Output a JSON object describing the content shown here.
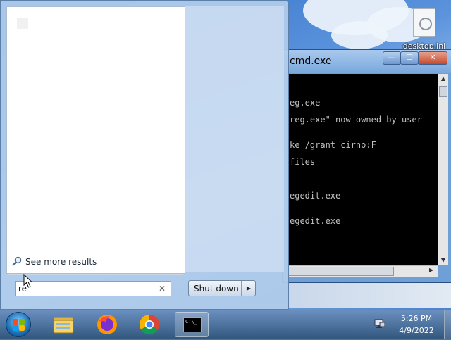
{
  "desktop": {
    "icon_label": "desktop.ini"
  },
  "cmd_window": {
    "title": "cmd.exe",
    "buttons": {
      "minimize": "—",
      "maximize": "☐",
      "close": "✕"
    },
    "lines": [
      "eg.exe",
      "reg.exe\" now owned by user",
      "ke /grant cirno:F",
      "files",
      "egedit.exe",
      "egedit.exe"
    ]
  },
  "start_menu": {
    "see_more_label": "See more results",
    "search": {
      "value": "re",
      "placeholder": ""
    },
    "shutdown_label": "Shut down"
  },
  "taskbar": {
    "cmd_glyph": "C:\\_",
    "clock": {
      "time": "5:26 PM",
      "date": "4/9/2022"
    }
  },
  "colors": {
    "desktop_blue": "#3d79c9",
    "start_menu_glass": "#b2cdeb",
    "console_bg": "#000000",
    "console_text": "#c0c0c0",
    "close_red": "#c44a2c"
  },
  "icons": {
    "search": "magnifier-icon",
    "clear": "close-icon",
    "shutdown_options": "triangle-right-icon",
    "start": "windows-logo-icon"
  }
}
